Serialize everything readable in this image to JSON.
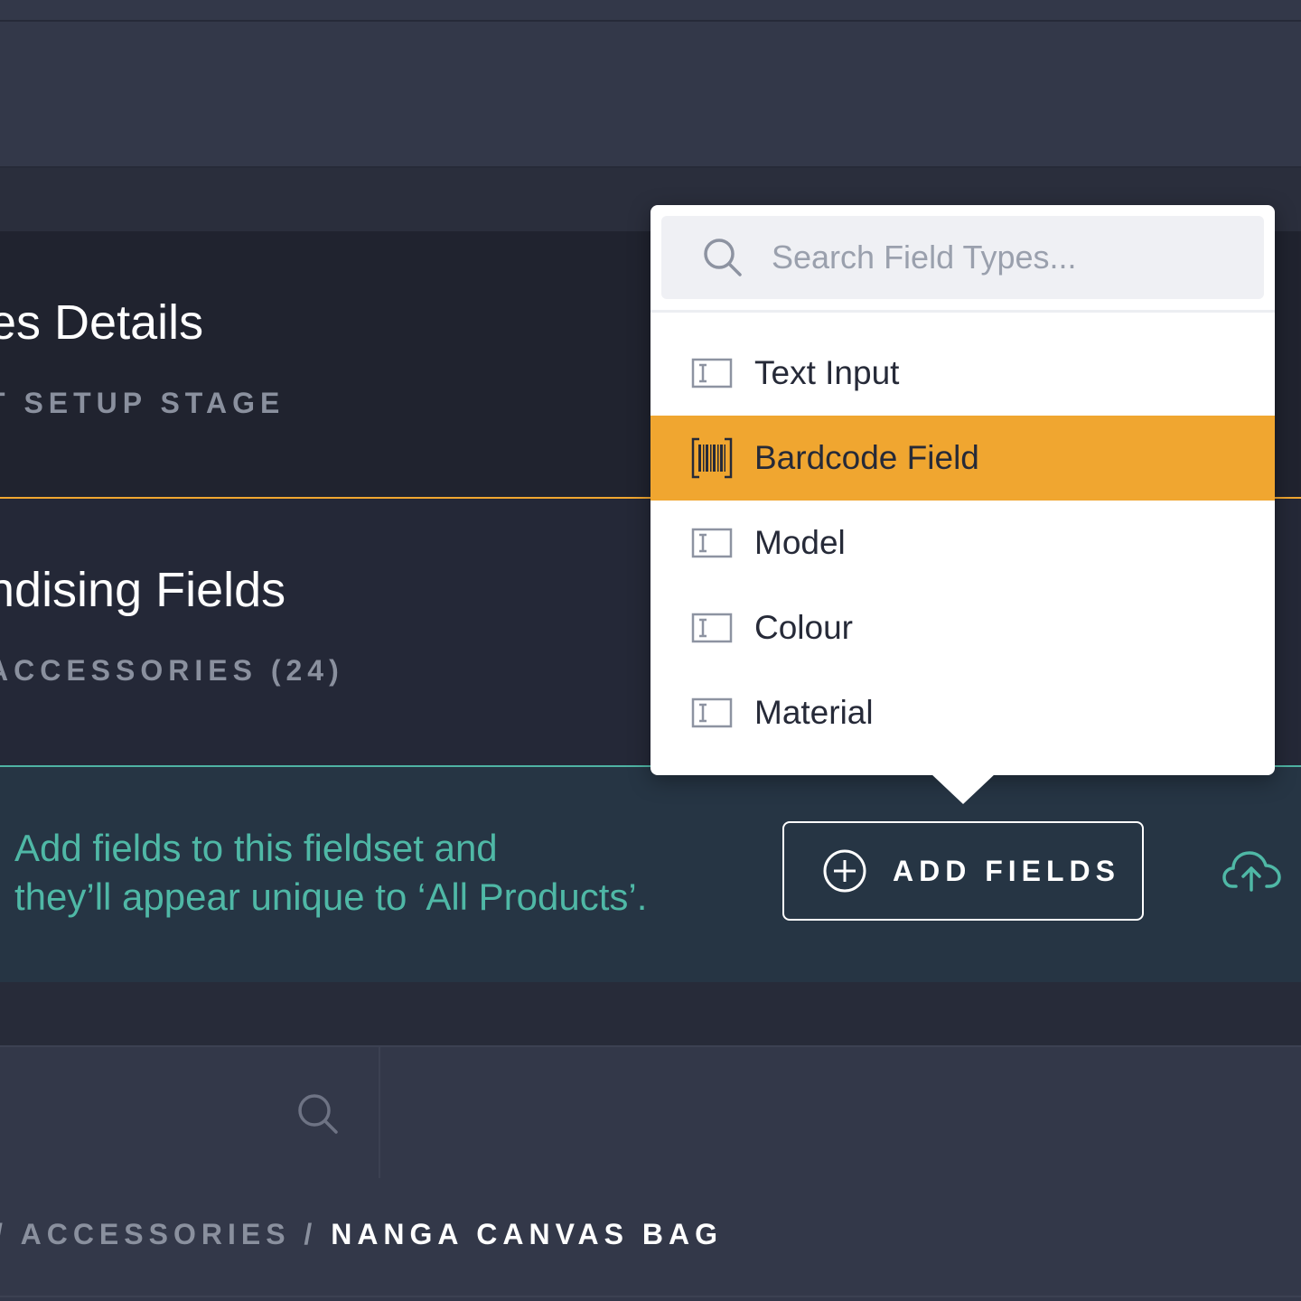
{
  "fieldsets": [
    {
      "title": "es Details",
      "subtitle": "T SETUP STAGE"
    },
    {
      "title": "ndising Fields",
      "subtitle": "ACCESSORIES (24)"
    }
  ],
  "prompt": {
    "line1": "Add fields to this fieldset and",
    "line2": "they’ll appear unique to ‘All Products’."
  },
  "add_fields_button": {
    "label": "ADD FIELDS"
  },
  "field_type_picker": {
    "search_placeholder": "Search Field Types...",
    "items": [
      {
        "label": "Text Input",
        "icon": "text-input-icon",
        "selected": false
      },
      {
        "label": "Bardcode Field",
        "icon": "barcode-icon",
        "selected": true
      },
      {
        "label": "Model",
        "icon": "text-input-icon",
        "selected": false
      },
      {
        "label": "Colour",
        "icon": "text-input-icon",
        "selected": false
      },
      {
        "label": "Material",
        "icon": "text-input-icon",
        "selected": false
      }
    ]
  },
  "breadcrumb": {
    "lead": "/ ACCESSORIES / ",
    "current": "NANGA CANVAS BAG"
  },
  "colors": {
    "accent_orange": "#f0a630",
    "accent_teal": "#4fb8a6",
    "background": "#323749"
  }
}
